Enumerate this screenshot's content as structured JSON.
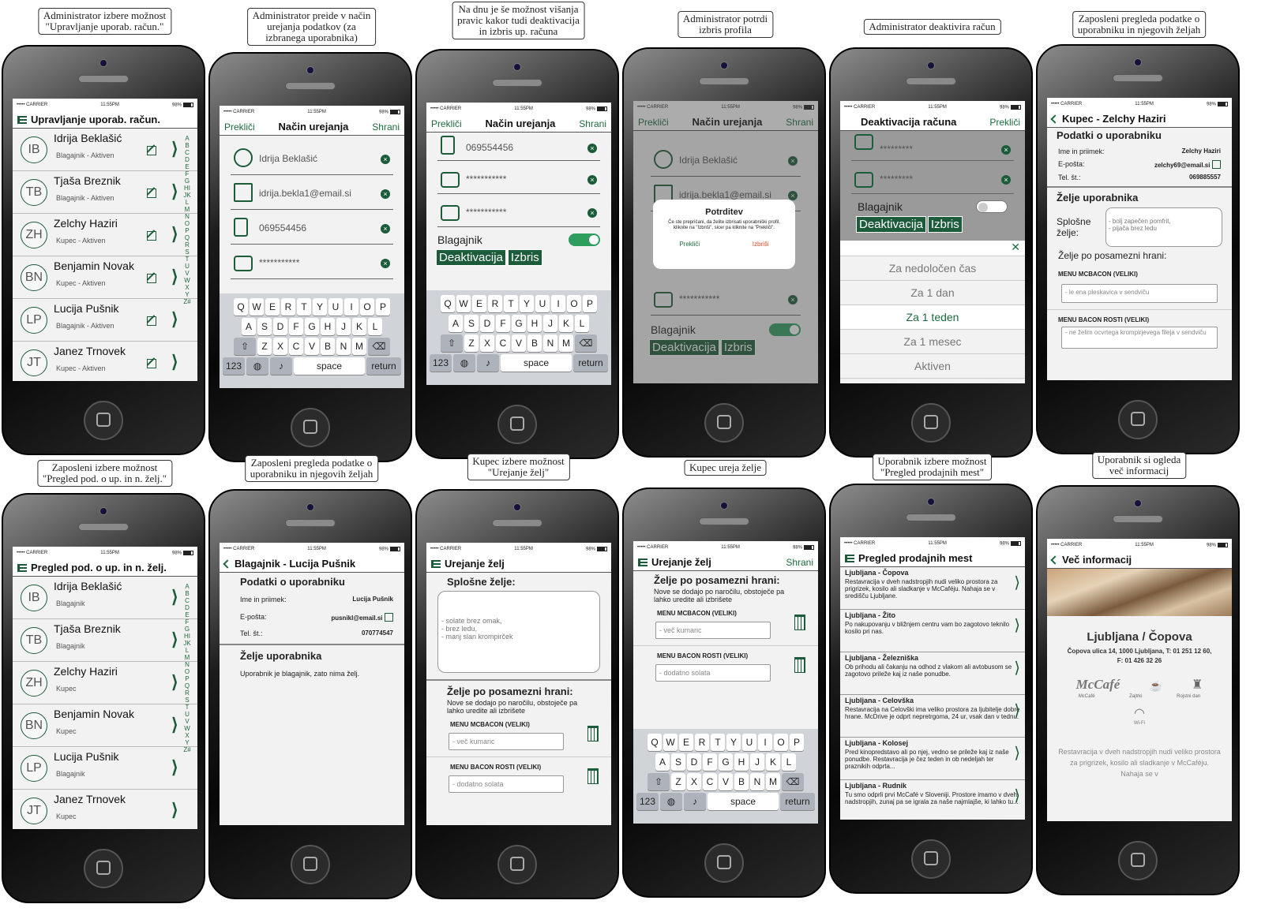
{
  "colors": {
    "accent": "#1d5c3a",
    "toggle": "#2e9e5f",
    "delete": "#e0502d"
  },
  "status_bar": {
    "carrier": "••••• CARRIER",
    "time": "11:55PM",
    "battery": "98%"
  },
  "keyboard": {
    "row1": [
      "Q",
      "W",
      "E",
      "R",
      "T",
      "Y",
      "U",
      "I",
      "O",
      "P"
    ],
    "row2": [
      "A",
      "S",
      "D",
      "F",
      "G",
      "H",
      "J",
      "K",
      "L"
    ],
    "row3": [
      "Z",
      "X",
      "C",
      "V",
      "B",
      "N",
      "M"
    ],
    "num": "123",
    "space": "space",
    "return": "return"
  },
  "alphabet": "ABCDEFGHIJKLMNOPQRSTUVWXYZ#",
  "s1": {
    "caption": "Administrator izbere možnost\n\"Upravljanje uporab. račun.\"",
    "title": "Upravljanje uporab. račun.",
    "users": [
      {
        "initials": "IB",
        "name": "Idrija Beklašić",
        "status": "Blagajnik - Aktiven"
      },
      {
        "initials": "TB",
        "name": "Tjaša Breznik",
        "status": "Blagajnik - Aktiven"
      },
      {
        "initials": "ZH",
        "name": "Zelchy Haziri",
        "status": "Kupec - Aktiven"
      },
      {
        "initials": "BN",
        "name": "Benjamin Novak",
        "status": "Kupec - Aktiven"
      },
      {
        "initials": "LP",
        "name": "Lucija Pušnik",
        "status": "Blagajnik - Aktiven"
      },
      {
        "initials": "JT",
        "name": "Janez Trnovek",
        "status": "Kupec - Aktiven"
      }
    ]
  },
  "s2": {
    "caption": "Administrator preide v način\nurejanja podatkov (za\nizbranega uporabnika)",
    "cancel": "Prekliči",
    "title": "Način urejanja",
    "save": "Shrani",
    "name": "Idrija Beklašić",
    "email": "idrija.bekla1@email.si",
    "phone": "069554456",
    "password": "***********"
  },
  "s3": {
    "caption": "Na dnu je še možnost višanja\npravic kakor tudi deaktivacija\nin izbris up. računa",
    "cancel": "Prekliči",
    "title": "Način urejanja",
    "save": "Shrani",
    "phone": "069554456",
    "password1": "***********",
    "password2": "***********",
    "role": "Blagajnik",
    "deactivate": "Deaktivacija",
    "delete": "Izbris"
  },
  "s4": {
    "caption": "Administrator potrdi\nizbris profila",
    "cancel": "Prekliči",
    "title": "Način urejanja",
    "save": "Shrani",
    "name": "Idrija Beklašić",
    "email": "idrija.bekla1@email.si",
    "password": "***********",
    "role": "Blagajnik",
    "deactivate": "Deaktivacija",
    "delete": "Izbris",
    "dialog": {
      "title": "Potrditev",
      "text": "Če ste prepričani, da želite izbrisati uporabniški profil, kliknite na \"Izbriši\", sicer pa kliknite na \"Prekliči\".",
      "cancel": "Prekliči",
      "confirm": "Izbriši"
    }
  },
  "s5": {
    "caption": "Administrator deaktivira račun",
    "title": "Deaktivacija računa",
    "cancel": "Prekliči",
    "password1": "*********",
    "password2": "*********",
    "role": "Blagajnik",
    "deactivate": "Deaktivacija",
    "delete": "Izbris",
    "options": [
      "Za nedoločen čas",
      "Za 1 dan",
      "Za 1 teden",
      "Za 1 mesec",
      "Aktiven"
    ],
    "selected": "Za 1 teden"
  },
  "s6": {
    "caption": "Zaposleni pregleda podatke o\nuporabniku in njegovih željah",
    "title": "Kupec - Zelchy Haziri",
    "section_user": "Podatki o uporabniku",
    "name_label": "Ime in priimek:",
    "name": "Zelchy Haziri",
    "email_label": "E-pošta:",
    "email": "zelchy69@email.si",
    "phone_label": "Tel. št.:",
    "phone": "069885557",
    "section_wishes": "Želje uporabnika",
    "general_label": "Splošne želje:",
    "general_value": "- bolj zapečen pomfrit,\n- pijača brez ledu",
    "per_food_label": "Želje po posamezni hrani:",
    "item1": "MENU MCBACON (VELIKI)",
    "item1_value": "- le ena pleskavica v sendviču",
    "item2": "MENU BACON ROSTI (VELIKI)",
    "item2_value": "- ne želim ocvrtega krompirjevega fileja v sendviču"
  },
  "s7": {
    "caption": "Zaposleni izbere možnost\n\"Pregled pod. o up. in n. želj.\"",
    "title": "Pregled pod. o up. in n. želj.",
    "users": [
      {
        "initials": "IB",
        "name": "Idrija Beklašić",
        "status": "Blagajnik"
      },
      {
        "initials": "TB",
        "name": "Tjaša Breznik",
        "status": "Blagajnik"
      },
      {
        "initials": "ZH",
        "name": "Zelchy Haziri",
        "status": "Kupec"
      },
      {
        "initials": "BN",
        "name": "Benjamin Novak",
        "status": "Kupec"
      },
      {
        "initials": "LP",
        "name": "Lucija Pušnik",
        "status": "Blagajnik"
      },
      {
        "initials": "JT",
        "name": "Janez Trnovek",
        "status": "Kupec"
      }
    ]
  },
  "s8": {
    "caption": "Zaposleni pregleda podatke o\nuporabniku in njegovih željah",
    "title": "Blagajnik - Lucija Pušnik",
    "section_user": "Podatki o uporabniku",
    "name_label": "Ime in priimek:",
    "name": "Lucija Pušnik",
    "email_label": "E-pošta:",
    "email": "pusnikl@email.si",
    "phone_label": "Tel. št.:",
    "phone": "070774547",
    "section_wishes": "Želje uporabnika",
    "note": "Uporabnik je blagajnik, zato nima želj."
  },
  "s9": {
    "caption": "Kupec izbere možnost\n\"Urejanje želj\"",
    "title": "Urejanje želj",
    "general_label": "Splošne želje:",
    "general_value": "- solate brez omak,\n- brez ledu,\n- manj slan krompirček",
    "per_food_label": "Želje po posamezni hrani:",
    "note": "Nove se dodajo po naročilu, obstoječe pa lahko uredite ali izbrišete",
    "item1": "MENU MCBACON (VELIKI)",
    "item1_value": "- več kumaric",
    "item2": "MENU BACON ROSTI (VELIKI)",
    "item2_value": "- dodatno solata"
  },
  "s10": {
    "caption": "Kupec ureja želje",
    "title": "Urejanje želj",
    "save": "Shrani",
    "per_food_label": "Želje po posamezni hrani:",
    "note": "Nove se dodajo po naročilu, obstoječe pa lahko uredite ali izbrišete",
    "item1": "MENU MCBACON (VELIKI)",
    "item1_value": "- več kumaric",
    "item2": "MENU BACON ROSTI (VELIKI)",
    "item2_value": "- dodatno solata"
  },
  "s11": {
    "caption": "Uporabnik izbere možnost\n\"Pregled prodajnih mest\"",
    "title": "Pregled prodajnih mest",
    "locations": [
      {
        "name": "Ljubljana - Čopova",
        "text": "Restavracija v dveh nadstropjih nudi veliko prostora za prigrizek, kosilo ali sladkanje v McCaféju. Nahaja se v središču Ljubljane."
      },
      {
        "name": "Ljubljana - Žito",
        "text": "Po nakupovanju v bližnjem centru vam bo zagotovo teknilo kosilo pri nas."
      },
      {
        "name": "Ljubljana - Železniška",
        "text": "Ob prihodu ali čakanju na odhod z vlakom ali avtobusom se zagotovo prileže kaj iz naše ponudbe."
      },
      {
        "name": "Ljubljana - Celovška",
        "text": "Restavracija na Celovški ima veliko prostora za ljubitelje dobre hrane. McDrive je odprt nepretrgoma, 24 ur, vsak dan v tednu."
      },
      {
        "name": "Ljubljana - Kolosej",
        "text": "Pred kinopredstavo ali po njej, vedno se prileže kaj iz naše ponudbe. Restavracija je čez teden in ob nedeljah ter praznikih odprta..."
      },
      {
        "name": "Ljubljana - Rudnik",
        "text": "Tu smo odprli prvi McCafé v Sloveniji. Prostore imamo v dveh nadstropjih, zunaj pa se igrala za naše najmlajše, ki lahko tu..."
      }
    ]
  },
  "s12": {
    "caption": "Uporabnik si ogleda\nveč informacij",
    "title": "Več informacij",
    "place": "Ljubljana / Čopova",
    "address": "Čopova ulica 14, 1000 Ljubljana, T: 01 251 12 60, F: 01 426 32 26",
    "features": [
      "McCafé",
      "Zajtrki",
      "Rojstni dan",
      "Wi-Fi"
    ],
    "logo_text": "McCafé",
    "description": "Restavracija v dveh nadstropjih nudi veliko prostora za prigrizek, kosilo ali sladkanje v McCaféju. Nahaja se v"
  }
}
